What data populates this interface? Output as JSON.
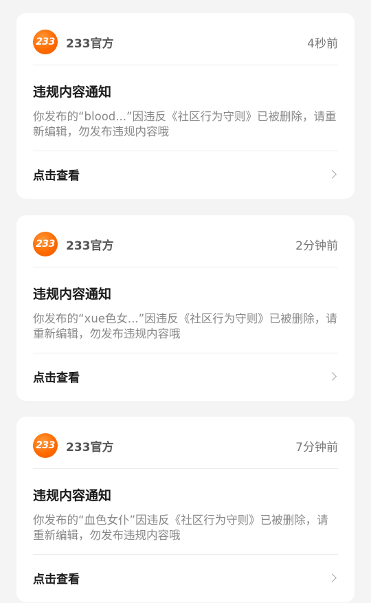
{
  "notifications": [
    {
      "avatar_text": "233",
      "sender": "233官方",
      "time": "4秒前",
      "title": "违规内容通知",
      "message": "你发布的“blood...”因违反《社区行为守则》已被删除，请重新编辑，勿发布违规内容哦",
      "action_label": "点击查看"
    },
    {
      "avatar_text": "233",
      "sender": "233官方",
      "time": "2分钟前",
      "title": "违规内容通知",
      "message": "你发布的“xue色女...”因违反《社区行为守则》已被删除，请重新编辑，勿发布违规内容哦",
      "action_label": "点击查看"
    },
    {
      "avatar_text": "233",
      "sender": "233官方",
      "time": "7分钟前",
      "title": "违规内容通知",
      "message": "你发布的“血色女仆”因违反《社区行为守则》已被删除，请重新编辑，勿发布违规内容哦",
      "action_label": "点击查看"
    }
  ],
  "colors": {
    "background": "#f4f4f4",
    "card": "#ffffff",
    "avatar_brand": "#ff6a00",
    "title_text": "#1a1a1a",
    "secondary_text": "#888888"
  },
  "icons": {
    "avatar": "233-logo-icon",
    "chevron": "chevron-right-icon"
  }
}
